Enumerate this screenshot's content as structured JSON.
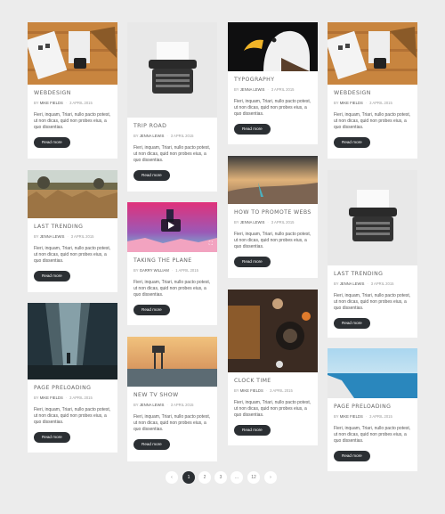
{
  "excerpt": "Fieri, inquam, Triari, nullo pacto potest, ut non dicas, quid non probes eius, a quo dissentias.",
  "read_more": "Read more",
  "by": "BY",
  "cards": {
    "c1": {
      "title": "WEBDESIGN",
      "author": "MIKE FIELDS",
      "date": "3 APRIL 2015"
    },
    "c2": {
      "title": "LAST TRENDING",
      "author": "JENNA LEWIS",
      "date": "3 APRIL 2015"
    },
    "c3": {
      "title": "PAGE PRELOADING",
      "author": "MIKE FIELDS",
      "date": "3 APRIL 2015"
    },
    "c4": {
      "title": "TRIP ROAD",
      "author": "JENNA LEWIS",
      "date": "3 APRIL 2015"
    },
    "c5": {
      "title": "TAKING THE PLANE",
      "author": "GARRY WILLIAM",
      "date": "1 APRIL 2015"
    },
    "c6": {
      "title": "NEW TV SHOW",
      "author": "JENNA LEWIS",
      "date": "3 APRIL 2015"
    },
    "c7": {
      "title": "TYPOGRAPHY",
      "author": "JENNA LEWIS",
      "date": "3 APRIL 2015"
    },
    "c8": {
      "title": "HOW TO PROMOTE WEBSITE?",
      "author": "JENNA LEWIS",
      "date": "3 APRIL 2015"
    },
    "c9": {
      "title": "CLOCK TIME",
      "author": "MIKE FIELDS",
      "date": "3 APRIL 2015"
    },
    "c10": {
      "title": "WEBDESIGN",
      "author": "MIKE FIELDS",
      "date": "3 APRIL 2015"
    },
    "c11": {
      "title": "LAST TRENDING",
      "author": "JENNA LEWIS",
      "date": "3 APRIL 2015"
    },
    "c12": {
      "title": "PAGE PRELOADING",
      "author": "MIKE FIELDS",
      "date": "3 APRIL 2015"
    }
  },
  "pagination": {
    "prev": "‹",
    "p1": "1",
    "p2": "2",
    "p3": "3",
    "ellipsis": "...",
    "last": "12",
    "next": "›"
  },
  "colors": {
    "button": "#2b2f33",
    "background": "#ececec"
  }
}
